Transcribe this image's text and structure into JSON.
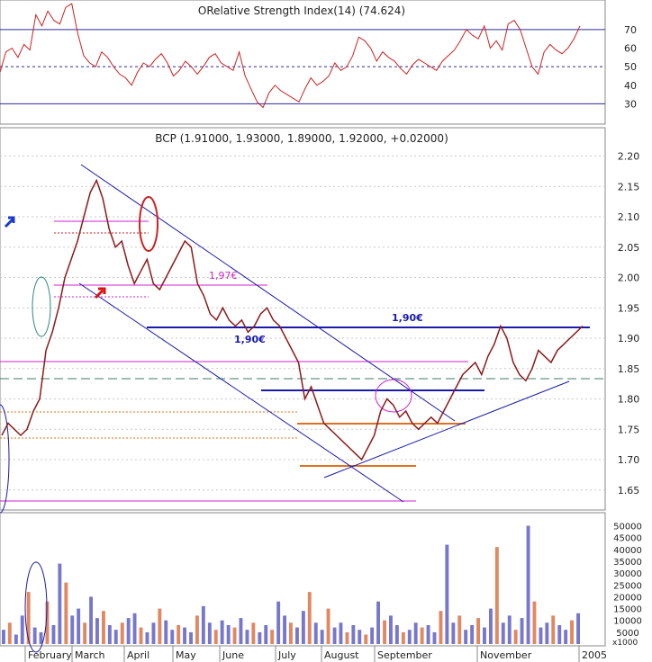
{
  "chart_data": [
    {
      "panel": "indicator",
      "type": "line",
      "title": "ORelative Strength Index(14) (74.624)",
      "y_ticks": [
        30,
        40,
        50,
        60,
        70
      ],
      "ylim": [
        20,
        85
      ],
      "reference_lines": {
        "upper": 70,
        "middle": 50,
        "lower": 30
      },
      "series": [
        {
          "color": "#cc2222",
          "values": [
            47,
            58,
            60,
            55,
            62,
            59,
            78,
            72,
            80,
            75,
            73,
            82,
            84,
            68,
            56,
            52,
            50,
            58,
            55,
            50,
            46,
            44,
            40,
            47,
            52,
            50,
            54,
            57,
            52,
            45,
            48,
            53,
            50,
            46,
            50,
            55,
            57,
            52,
            50,
            48,
            58,
            45,
            38,
            31,
            28,
            36,
            40,
            37,
            35,
            33,
            31,
            38,
            44,
            40,
            42,
            45,
            52,
            48,
            50,
            56,
            66,
            64,
            60,
            53,
            58,
            55,
            53,
            49,
            46,
            51,
            54,
            52,
            50,
            48,
            53,
            56,
            59,
            64,
            70,
            67,
            65,
            72,
            60,
            64,
            59,
            73,
            75,
            70,
            60,
            50,
            46,
            58,
            62,
            59,
            57,
            60,
            65,
            72
          ]
        }
      ]
    },
    {
      "panel": "price",
      "type": "line",
      "title": "BCP (1.91000, 1.93000, 1.89000, 1.92000, +0.02000)",
      "y_ticks": [
        1.65,
        1.7,
        1.75,
        1.8,
        1.85,
        1.9,
        1.95,
        2.0,
        2.05,
        2.1,
        2.15,
        2.2
      ],
      "ylim": [
        1.62,
        2.22
      ],
      "annotations": [
        "1,97€",
        "1,90€",
        "1,90€"
      ],
      "series": [
        {
          "name": "close",
          "color": "#8b1a1a",
          "values": [
            1.74,
            1.76,
            1.75,
            1.74,
            1.75,
            1.78,
            1.8,
            1.88,
            1.91,
            1.95,
            2.0,
            2.03,
            2.06,
            2.1,
            2.14,
            2.16,
            2.13,
            2.08,
            2.05,
            2.06,
            2.02,
            1.99,
            2.01,
            2.03,
            1.99,
            1.98,
            2.0,
            2.02,
            2.04,
            2.06,
            2.05,
            1.99,
            1.97,
            1.94,
            1.93,
            1.95,
            1.93,
            1.92,
            1.93,
            1.91,
            1.92,
            1.94,
            1.95,
            1.93,
            1.92,
            1.9,
            1.88,
            1.86,
            1.8,
            1.82,
            1.79,
            1.76,
            1.75,
            1.74,
            1.73,
            1.72,
            1.71,
            1.7,
            1.72,
            1.74,
            1.78,
            1.8,
            1.79,
            1.77,
            1.78,
            1.76,
            1.75,
            1.76,
            1.77,
            1.76,
            1.78,
            1.8,
            1.82,
            1.84,
            1.85,
            1.86,
            1.84,
            1.87,
            1.89,
            1.92,
            1.9,
            1.86,
            1.84,
            1.83,
            1.85,
            1.88,
            1.87,
            1.86,
            1.88,
            1.89,
            1.9,
            1.91,
            1.92
          ]
        }
      ]
    },
    {
      "panel": "volume",
      "type": "bar",
      "y_ticks": [
        5000,
        10000,
        15000,
        20000,
        25000,
        30000,
        35000,
        40000,
        45000,
        50000
      ],
      "ylabel": "x1000",
      "ylim": [
        0,
        54000
      ],
      "values": [
        6000,
        9000,
        4000,
        12000,
        22000,
        7000,
        5000,
        18000,
        8000,
        34000,
        26000,
        12000,
        15000,
        9000,
        20000,
        11000,
        14000,
        8000,
        6000,
        9000,
        11000,
        13000,
        7000,
        5000,
        9000,
        15000,
        10000,
        6000,
        8000,
        7000,
        5000,
        12000,
        16000,
        9000,
        6000,
        10000,
        8000,
        7000,
        11000,
        6000,
        9000,
        5000,
        8000,
        6000,
        18000,
        12000,
        9000,
        7000,
        14000,
        22000,
        9000,
        6000,
        15000,
        7000,
        9000,
        5000,
        8000,
        6000,
        4000,
        7000,
        18000,
        10000,
        12000,
        8000,
        5000,
        6000,
        9000,
        7000,
        8000,
        5000,
        14000,
        42000,
        9000,
        12000,
        6000,
        8000,
        11000,
        7000,
        15000,
        41000,
        9000,
        12000,
        6000,
        11000,
        50000,
        18000,
        7000,
        9000,
        12000,
        8000,
        6000,
        10000,
        13000
      ]
    }
  ],
  "x_axis": {
    "labels": [
      "February",
      "March",
      "April",
      "May",
      "June",
      "July",
      "August",
      "September",
      "November",
      "2005"
    ]
  },
  "colors": {
    "price_line": "#8b1a1a",
    "price_up": "#2a2a8f",
    "rsi_line": "#cc2222",
    "trendline": "#1a1aaa",
    "support": "#e07020",
    "magenta": "#cc22cc",
    "volume_bar": "#7777cc",
    "volume_alt": "#e08860",
    "grid": "#c8c8c8"
  }
}
